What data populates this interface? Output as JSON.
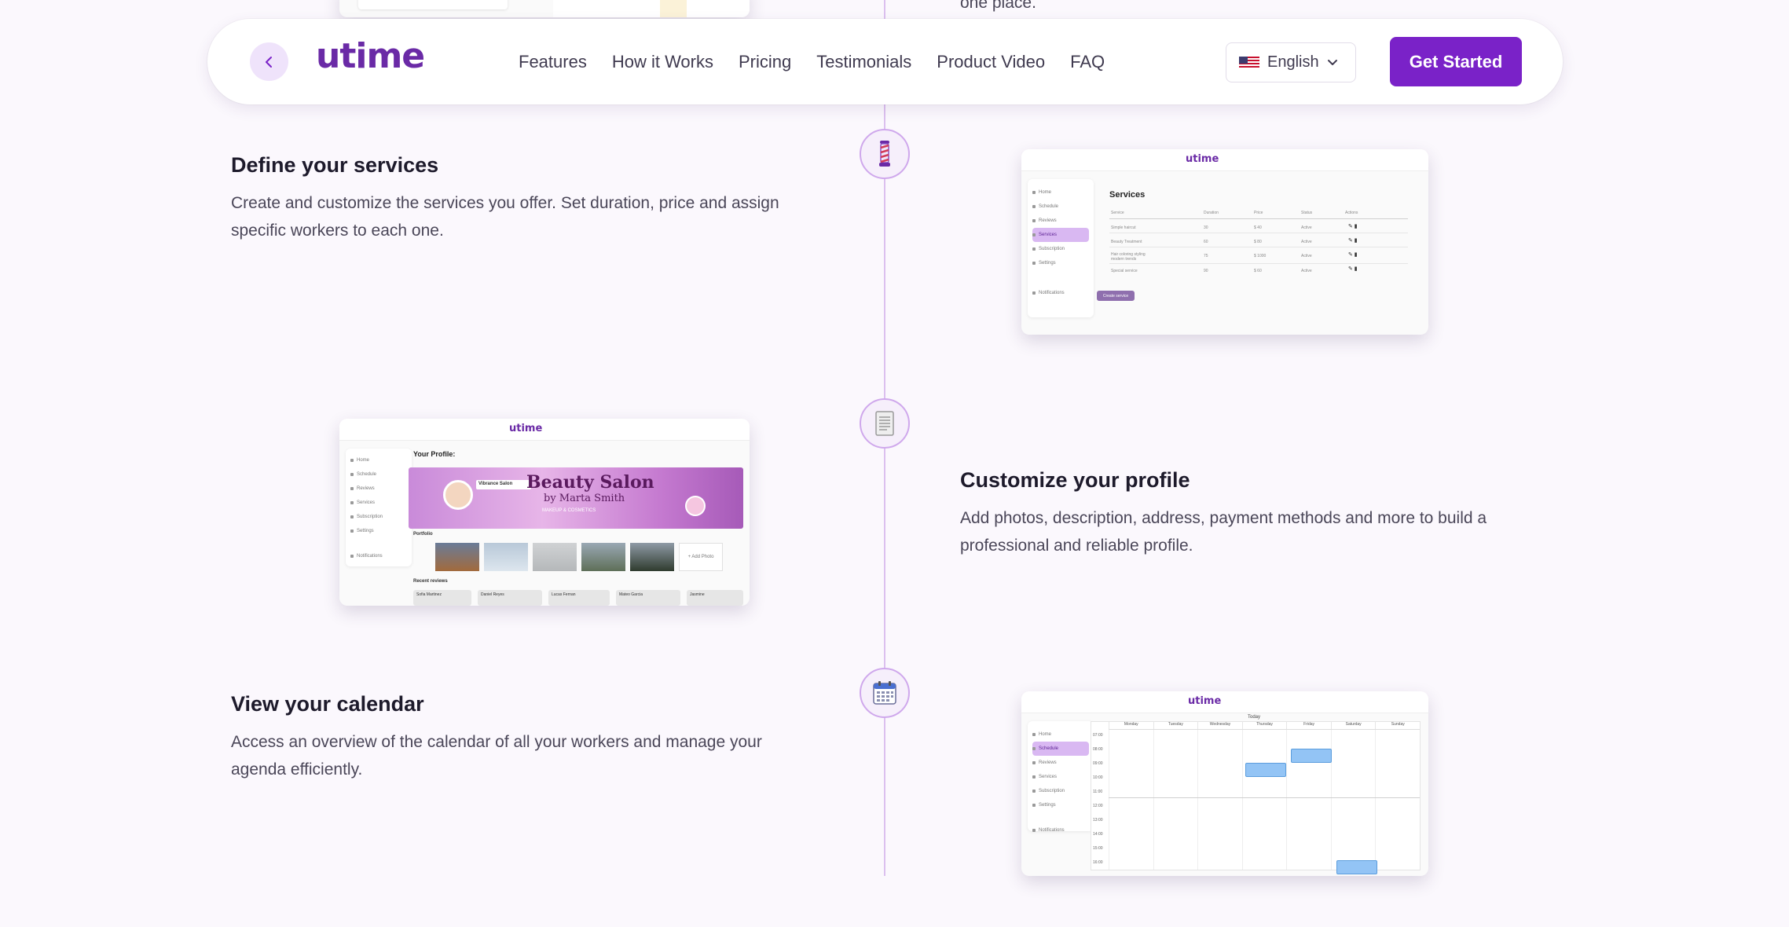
{
  "nav": {
    "logo": "utime",
    "links": [
      "Features",
      "How it Works",
      "Pricing",
      "Testimonials",
      "Product Video",
      "FAQ"
    ],
    "language": "English",
    "cta": "Get Started"
  },
  "top_snippet": "one place.",
  "sections": [
    {
      "title": "Define your services",
      "description": "Create and customize the services you offer. Set duration, price and assign specific workers to each one.",
      "icon": "barber-pole-icon"
    },
    {
      "title": "Customize your profile",
      "description": "Add photos, description, address, payment methods and more to build a professional and reliable profile.",
      "icon": "document-icon"
    },
    {
      "title": "View your calendar",
      "description": "Access an overview of the calendar of all your workers and manage your agenda efficiently.",
      "icon": "calendar-icon"
    }
  ],
  "services_shot": {
    "logo": "utime",
    "heading": "Services",
    "columns": [
      "Service",
      "Duration",
      "Price",
      "Status",
      "Actions"
    ],
    "rows": [
      [
        "Simple haircut",
        "30",
        "$ 40",
        "Active"
      ],
      [
        "Beauty Treatment",
        "60",
        "$ 80",
        "Active"
      ],
      [
        "Hair coloring styling modern trends",
        "75",
        "$ 1000",
        "Active"
      ],
      [
        "Special service",
        "90",
        "$ 60",
        "Active"
      ]
    ],
    "sidebar": [
      "Home",
      "Schedule",
      "Reviews",
      "Services",
      "Subscription",
      "Settings",
      "Notifications"
    ],
    "button": "Create service"
  },
  "profile_shot": {
    "logo": "utime",
    "heading": "Your Profile:",
    "banner_title": "Beauty Salon",
    "banner_sub": "by Marta Smith",
    "banner_tag": "MAKEUP & COSMETICS",
    "name_badge": "Vibrance Salon",
    "portfolio": "Portfolio",
    "add_photo": "+ Add Photo",
    "reviews": "Recent reviews",
    "reviewers": [
      "Sofia Martinez",
      "Daniel Reyes",
      "Lucas Fernan",
      "Mateo Garcia",
      "Jasmine"
    ],
    "sidebar": [
      "Home",
      "Schedule",
      "Reviews",
      "Services",
      "Subscription",
      "Settings",
      "Notifications"
    ]
  },
  "calendar_shot": {
    "logo": "utime",
    "today": "Today",
    "days": [
      "Monday",
      "Tuesday",
      "Wednesday",
      "Thursday",
      "Friday",
      "Saturday",
      "Sunday"
    ],
    "hours": [
      "07:00",
      "08:00",
      "09:00",
      "10:00",
      "11:00",
      "12:00",
      "13:00",
      "14:00",
      "15:00",
      "16:00"
    ],
    "sidebar": [
      "Home",
      "Schedule",
      "Reviews",
      "Services",
      "Subscription",
      "Settings",
      "Notifications"
    ]
  },
  "colors": {
    "accent": "#7a22c8",
    "logo": "#6a2aa6",
    "timeline": "#dcc0ef"
  }
}
